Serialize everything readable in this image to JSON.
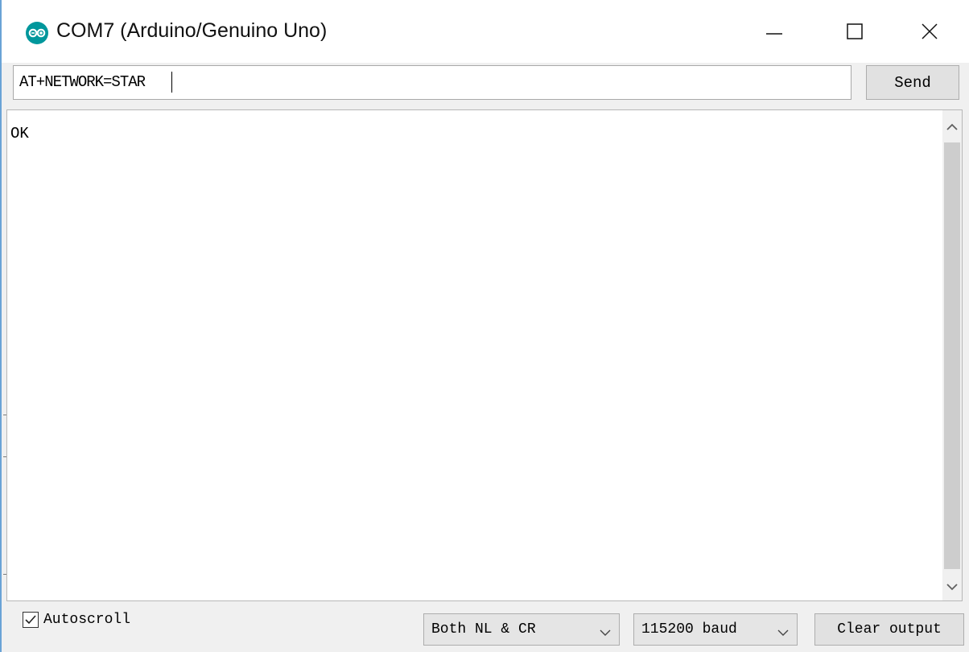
{
  "window": {
    "title": "COM7 (Arduino/Genuino Uno)",
    "icon": "arduino-logo-icon",
    "accent_color": "#00979c",
    "controls": [
      "minimize-icon",
      "maximize-icon",
      "close-icon"
    ]
  },
  "input": {
    "value": "AT+NETWORK=STAR",
    "send_label": "Send"
  },
  "output": {
    "text": "OK"
  },
  "footer": {
    "autoscroll_label": "Autoscroll",
    "autoscroll_checked": true,
    "line_ending": "Both NL & CR",
    "baud_rate": "115200 baud",
    "clear_label": "Clear output"
  }
}
